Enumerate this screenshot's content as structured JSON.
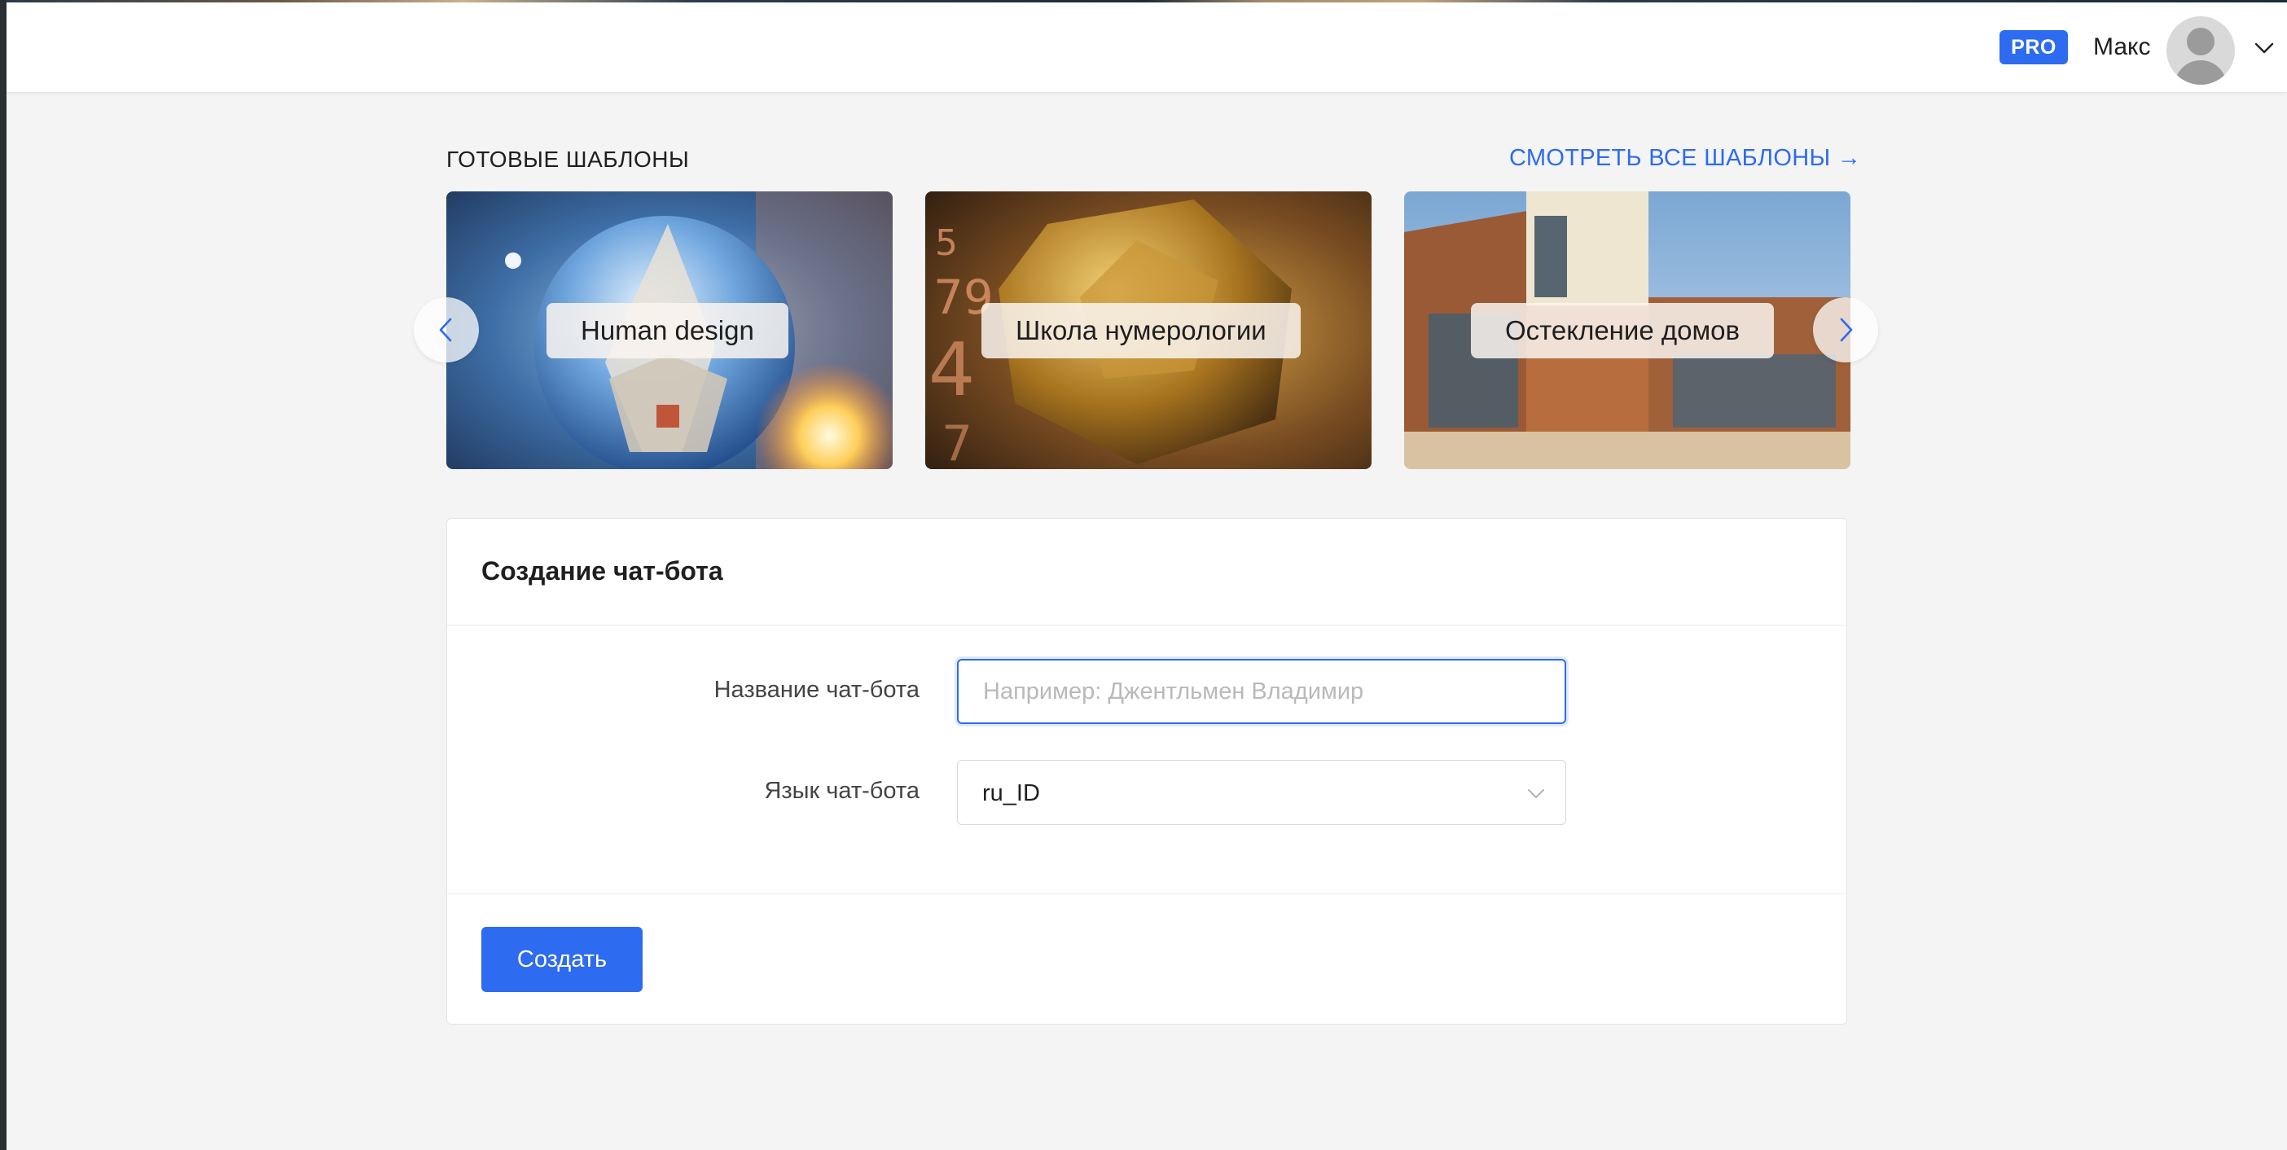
{
  "header": {
    "pro_badge": "PRO",
    "user_name": "Макс"
  },
  "templates": {
    "section_title": "ГОТОВЫЕ ШАБЛОНЫ",
    "see_all_label": "СМОТРЕТЬ ВСЕ ШАБЛОНЫ →",
    "cards": [
      {
        "label": "Human design"
      },
      {
        "label": "Школа нумерологии"
      },
      {
        "label": "Остекление домов"
      }
    ]
  },
  "form": {
    "title": "Создание чат-бота",
    "name_label": "Название чат-бота",
    "name_placeholder": "Например: Джентльмен Владимир",
    "name_value": "",
    "lang_label": "Язык чат-бота",
    "lang_value": "ru_ID",
    "submit_label": "Создать"
  },
  "colors": {
    "accent": "#2d6bf0",
    "background": "#f4f4f4"
  }
}
